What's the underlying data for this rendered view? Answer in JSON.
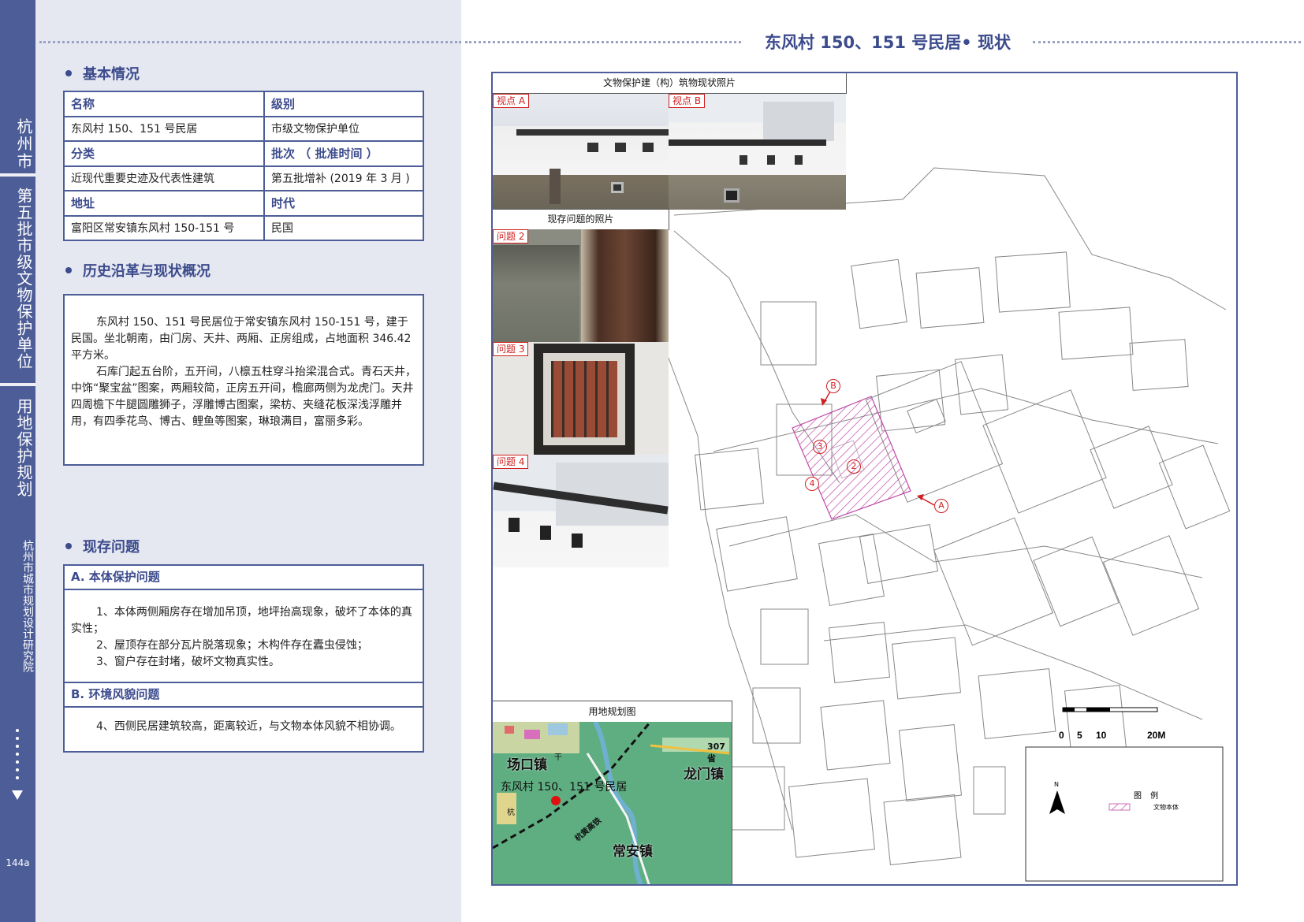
{
  "sidebar": {
    "city": "杭州市",
    "batch": "第五批市级文物保护单位",
    "plan": "用地保护规划",
    "institute": "杭州市城市规划设计研究院",
    "page_number": "144a"
  },
  "page_title": "东风村 150、151 号民居• 现状",
  "basic": {
    "title": "基本情况",
    "rows": [
      [
        "名称",
        "级别"
      ],
      [
        "东风村 150、151 号民居",
        "市级文物保护单位"
      ],
      [
        "分类",
        "批次 （ 批准时间 ）"
      ],
      [
        "近现代重要史迹及代表性建筑",
        "第五批增补 (2019 年 3 月 )"
      ],
      [
        "地址",
        "时代"
      ],
      [
        "富阳区常安镇东风村 150-151 号",
        "民国"
      ]
    ]
  },
  "history": {
    "title": "历史沿革与现状概况",
    "p1": "东风村 150、151 号民居位于常安镇东风村 150-151 号，建于民国。坐北朝南，由门房、天井、两厢、正房组成，占地面积 346.42 平方米。",
    "p2": "石库门起五台阶，五开间，八檩五柱穿斗抬梁混合式。青石天井，中饰“聚宝盆”图案，两厢较简，正房五开间，檐廊两侧为龙虎门。天井四周檐下牛腿圆雕狮子，浮雕博古图案，梁枋、夹缝花板深浅浮雕并用，有四季花鸟、博古、鲤鱼等图案，琳琅满目，富丽多彩。"
  },
  "issues": {
    "title": "现存问题",
    "a_head": "A. 本体保护问题",
    "a1": "1、本体两侧厢房存在增加吊顶，地坪抬高现象，破坏了本体的真实性；",
    "a2": "2、屋顶存在部分瓦片脱落现象；木构件存在蠹虫侵蚀；",
    "a3": "3、窗户存在封堵，破坏文物真实性。",
    "b_head": "B. 环境风貌问题",
    "b1": "4、西侧民居建筑较高，距离较近，与文物本体风貌不相协调。"
  },
  "photos": {
    "caption_status": "文物保护建（构）筑物现状照片",
    "caption_problems": "现存问题的照片",
    "view_a": "视点 A",
    "view_b": "视点 B",
    "problem2": "问题 2",
    "problem3": "问题 3",
    "problem4": "问题 4"
  },
  "map": {
    "markers": [
      "B",
      "A",
      "2",
      "3",
      "4"
    ],
    "scale": {
      "ticks": [
        "0",
        "5",
        "10",
        "20M"
      ]
    },
    "legend_title": "图 例",
    "legend_item": "文物本体",
    "north": "N",
    "colors": {
      "heritage_hatch": "#c04aa8",
      "frame": "#4d5d97",
      "marker": "#d02020"
    }
  },
  "locator": {
    "caption": "用地规划图",
    "labels": {
      "changkou": "场口镇",
      "longmen": "龙门镇",
      "changan": "常安镇",
      "site": "东风村 150、151 号民居",
      "road": "307省",
      "rail": "杭黄高铁",
      "hang": "杭",
      "gan": "干"
    }
  }
}
